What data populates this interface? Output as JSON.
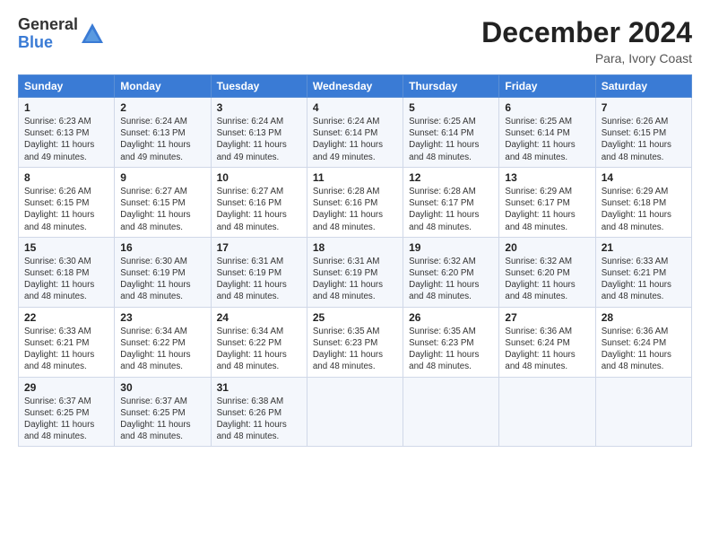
{
  "logo": {
    "general": "General",
    "blue": "Blue"
  },
  "title": "December 2024",
  "subtitle": "Para, Ivory Coast",
  "headers": [
    "Sunday",
    "Monday",
    "Tuesday",
    "Wednesday",
    "Thursday",
    "Friday",
    "Saturday"
  ],
  "weeks": [
    [
      {
        "day": "1",
        "sr": "Sunrise: 6:23 AM",
        "ss": "Sunset: 6:13 PM",
        "dl": "Daylight: 11 hours and 49 minutes."
      },
      {
        "day": "2",
        "sr": "Sunrise: 6:24 AM",
        "ss": "Sunset: 6:13 PM",
        "dl": "Daylight: 11 hours and 49 minutes."
      },
      {
        "day": "3",
        "sr": "Sunrise: 6:24 AM",
        "ss": "Sunset: 6:13 PM",
        "dl": "Daylight: 11 hours and 49 minutes."
      },
      {
        "day": "4",
        "sr": "Sunrise: 6:24 AM",
        "ss": "Sunset: 6:14 PM",
        "dl": "Daylight: 11 hours and 49 minutes."
      },
      {
        "day": "5",
        "sr": "Sunrise: 6:25 AM",
        "ss": "Sunset: 6:14 PM",
        "dl": "Daylight: 11 hours and 48 minutes."
      },
      {
        "day": "6",
        "sr": "Sunrise: 6:25 AM",
        "ss": "Sunset: 6:14 PM",
        "dl": "Daylight: 11 hours and 48 minutes."
      },
      {
        "day": "7",
        "sr": "Sunrise: 6:26 AM",
        "ss": "Sunset: 6:15 PM",
        "dl": "Daylight: 11 hours and 48 minutes."
      }
    ],
    [
      {
        "day": "8",
        "sr": "Sunrise: 6:26 AM",
        "ss": "Sunset: 6:15 PM",
        "dl": "Daylight: 11 hours and 48 minutes."
      },
      {
        "day": "9",
        "sr": "Sunrise: 6:27 AM",
        "ss": "Sunset: 6:15 PM",
        "dl": "Daylight: 11 hours and 48 minutes."
      },
      {
        "day": "10",
        "sr": "Sunrise: 6:27 AM",
        "ss": "Sunset: 6:16 PM",
        "dl": "Daylight: 11 hours and 48 minutes."
      },
      {
        "day": "11",
        "sr": "Sunrise: 6:28 AM",
        "ss": "Sunset: 6:16 PM",
        "dl": "Daylight: 11 hours and 48 minutes."
      },
      {
        "day": "12",
        "sr": "Sunrise: 6:28 AM",
        "ss": "Sunset: 6:17 PM",
        "dl": "Daylight: 11 hours and 48 minutes."
      },
      {
        "day": "13",
        "sr": "Sunrise: 6:29 AM",
        "ss": "Sunset: 6:17 PM",
        "dl": "Daylight: 11 hours and 48 minutes."
      },
      {
        "day": "14",
        "sr": "Sunrise: 6:29 AM",
        "ss": "Sunset: 6:18 PM",
        "dl": "Daylight: 11 hours and 48 minutes."
      }
    ],
    [
      {
        "day": "15",
        "sr": "Sunrise: 6:30 AM",
        "ss": "Sunset: 6:18 PM",
        "dl": "Daylight: 11 hours and 48 minutes."
      },
      {
        "day": "16",
        "sr": "Sunrise: 6:30 AM",
        "ss": "Sunset: 6:19 PM",
        "dl": "Daylight: 11 hours and 48 minutes."
      },
      {
        "day": "17",
        "sr": "Sunrise: 6:31 AM",
        "ss": "Sunset: 6:19 PM",
        "dl": "Daylight: 11 hours and 48 minutes."
      },
      {
        "day": "18",
        "sr": "Sunrise: 6:31 AM",
        "ss": "Sunset: 6:19 PM",
        "dl": "Daylight: 11 hours and 48 minutes."
      },
      {
        "day": "19",
        "sr": "Sunrise: 6:32 AM",
        "ss": "Sunset: 6:20 PM",
        "dl": "Daylight: 11 hours and 48 minutes."
      },
      {
        "day": "20",
        "sr": "Sunrise: 6:32 AM",
        "ss": "Sunset: 6:20 PM",
        "dl": "Daylight: 11 hours and 48 minutes."
      },
      {
        "day": "21",
        "sr": "Sunrise: 6:33 AM",
        "ss": "Sunset: 6:21 PM",
        "dl": "Daylight: 11 hours and 48 minutes."
      }
    ],
    [
      {
        "day": "22",
        "sr": "Sunrise: 6:33 AM",
        "ss": "Sunset: 6:21 PM",
        "dl": "Daylight: 11 hours and 48 minutes."
      },
      {
        "day": "23",
        "sr": "Sunrise: 6:34 AM",
        "ss": "Sunset: 6:22 PM",
        "dl": "Daylight: 11 hours and 48 minutes."
      },
      {
        "day": "24",
        "sr": "Sunrise: 6:34 AM",
        "ss": "Sunset: 6:22 PM",
        "dl": "Daylight: 11 hours and 48 minutes."
      },
      {
        "day": "25",
        "sr": "Sunrise: 6:35 AM",
        "ss": "Sunset: 6:23 PM",
        "dl": "Daylight: 11 hours and 48 minutes."
      },
      {
        "day": "26",
        "sr": "Sunrise: 6:35 AM",
        "ss": "Sunset: 6:23 PM",
        "dl": "Daylight: 11 hours and 48 minutes."
      },
      {
        "day": "27",
        "sr": "Sunrise: 6:36 AM",
        "ss": "Sunset: 6:24 PM",
        "dl": "Daylight: 11 hours and 48 minutes."
      },
      {
        "day": "28",
        "sr": "Sunrise: 6:36 AM",
        "ss": "Sunset: 6:24 PM",
        "dl": "Daylight: 11 hours and 48 minutes."
      }
    ],
    [
      {
        "day": "29",
        "sr": "Sunrise: 6:37 AM",
        "ss": "Sunset: 6:25 PM",
        "dl": "Daylight: 11 hours and 48 minutes."
      },
      {
        "day": "30",
        "sr": "Sunrise: 6:37 AM",
        "ss": "Sunset: 6:25 PM",
        "dl": "Daylight: 11 hours and 48 minutes."
      },
      {
        "day": "31",
        "sr": "Sunrise: 6:38 AM",
        "ss": "Sunset: 6:26 PM",
        "dl": "Daylight: 11 hours and 48 minutes."
      },
      null,
      null,
      null,
      null
    ]
  ]
}
